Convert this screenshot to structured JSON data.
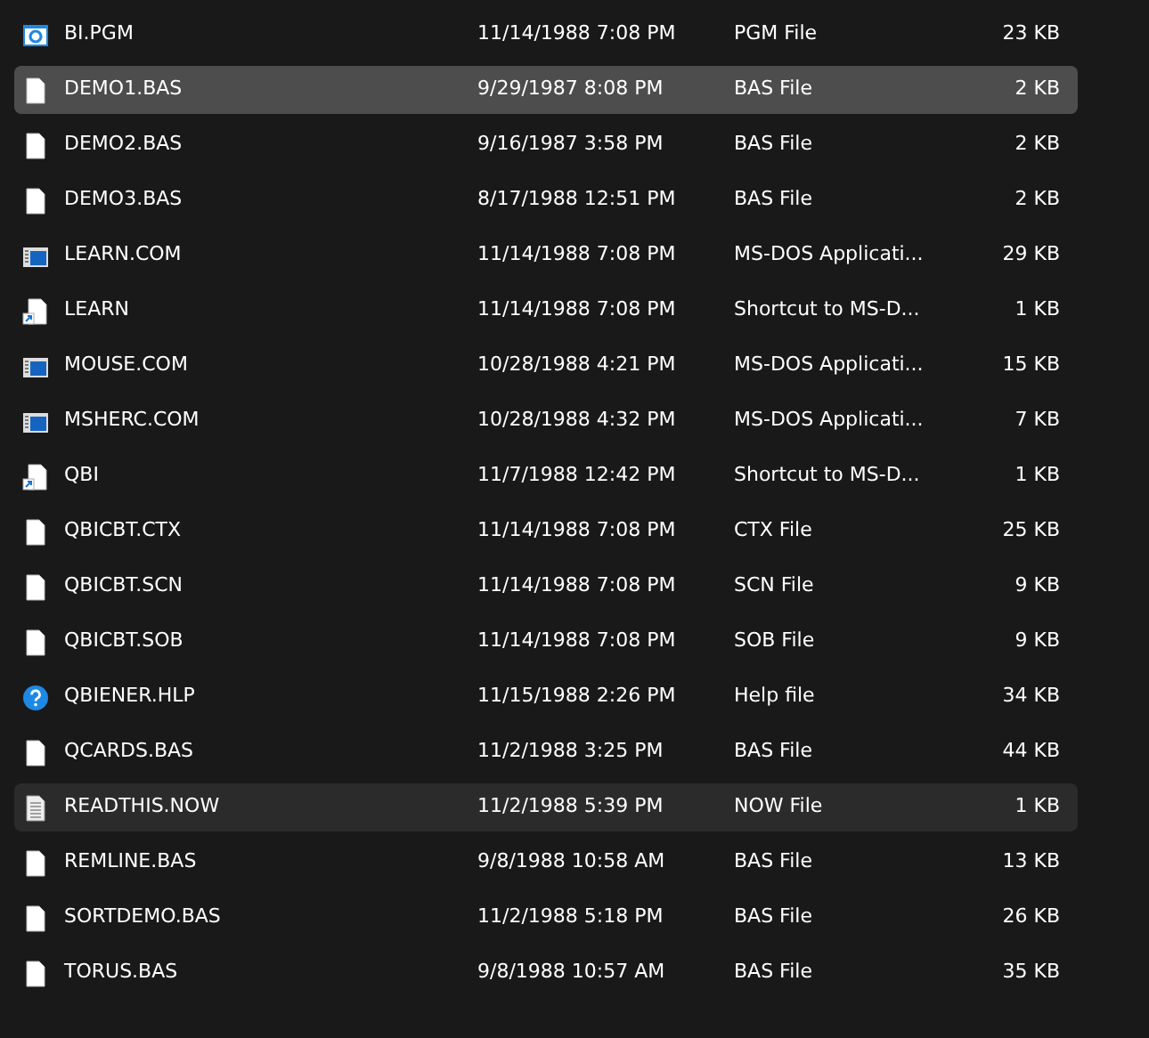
{
  "files": [
    {
      "name": "BI.PGM",
      "date": "11/14/1988 7:08 PM",
      "type": "PGM File",
      "size": "23 KB",
      "kind": "image",
      "selected": false,
      "hovered": false
    },
    {
      "name": "DEMO1.BAS",
      "date": "9/29/1987 8:08 PM",
      "type": "BAS File",
      "size": "2 KB",
      "kind": "document",
      "selected": true,
      "hovered": false
    },
    {
      "name": "DEMO2.BAS",
      "date": "9/16/1987 3:58 PM",
      "type": "BAS File",
      "size": "2 KB",
      "kind": "document",
      "selected": false,
      "hovered": false
    },
    {
      "name": "DEMO3.BAS",
      "date": "8/17/1988 12:51 PM",
      "type": "BAS File",
      "size": "2 KB",
      "kind": "document",
      "selected": false,
      "hovered": false
    },
    {
      "name": "LEARN.COM",
      "date": "11/14/1988 7:08 PM",
      "type": "MS-DOS Applicati...",
      "size": "29 KB",
      "kind": "application",
      "selected": false,
      "hovered": false
    },
    {
      "name": "LEARN",
      "date": "11/14/1988 7:08 PM",
      "type": "Shortcut to MS-D...",
      "size": "1 KB",
      "kind": "shortcut",
      "selected": false,
      "hovered": false
    },
    {
      "name": "MOUSE.COM",
      "date": "10/28/1988 4:21 PM",
      "type": "MS-DOS Applicati...",
      "size": "15 KB",
      "kind": "application",
      "selected": false,
      "hovered": false
    },
    {
      "name": "MSHERC.COM",
      "date": "10/28/1988 4:32 PM",
      "type": "MS-DOS Applicati...",
      "size": "7 KB",
      "kind": "application",
      "selected": false,
      "hovered": false
    },
    {
      "name": "QBI",
      "date": "11/7/1988 12:42 PM",
      "type": "Shortcut to MS-D...",
      "size": "1 KB",
      "kind": "shortcut",
      "selected": false,
      "hovered": false
    },
    {
      "name": "QBICBT.CTX",
      "date": "11/14/1988 7:08 PM",
      "type": "CTX File",
      "size": "25 KB",
      "kind": "document",
      "selected": false,
      "hovered": false
    },
    {
      "name": "QBICBT.SCN",
      "date": "11/14/1988 7:08 PM",
      "type": "SCN File",
      "size": "9 KB",
      "kind": "document",
      "selected": false,
      "hovered": false
    },
    {
      "name": "QBICBT.SOB",
      "date": "11/14/1988 7:08 PM",
      "type": "SOB File",
      "size": "9 KB",
      "kind": "document",
      "selected": false,
      "hovered": false
    },
    {
      "name": "QBIENER.HLP",
      "date": "11/15/1988 2:26 PM",
      "type": "Help file",
      "size": "34 KB",
      "kind": "help",
      "selected": false,
      "hovered": false
    },
    {
      "name": "QCARDS.BAS",
      "date": "11/2/1988 3:25 PM",
      "type": "BAS File",
      "size": "44 KB",
      "kind": "document",
      "selected": false,
      "hovered": false
    },
    {
      "name": "READTHIS.NOW",
      "date": "11/2/1988 5:39 PM",
      "type": "NOW File",
      "size": "1 KB",
      "kind": "text",
      "selected": false,
      "hovered": true
    },
    {
      "name": "REMLINE.BAS",
      "date": "9/8/1988 10:58 AM",
      "type": "BAS File",
      "size": "13 KB",
      "kind": "document",
      "selected": false,
      "hovered": false
    },
    {
      "name": "SORTDEMO.BAS",
      "date": "11/2/1988 5:18 PM",
      "type": "BAS File",
      "size": "26 KB",
      "kind": "document",
      "selected": false,
      "hovered": false
    },
    {
      "name": "TORUS.BAS",
      "date": "9/8/1988 10:57 AM",
      "type": "BAS File",
      "size": "35 KB",
      "kind": "document",
      "selected": false,
      "hovered": false
    }
  ]
}
